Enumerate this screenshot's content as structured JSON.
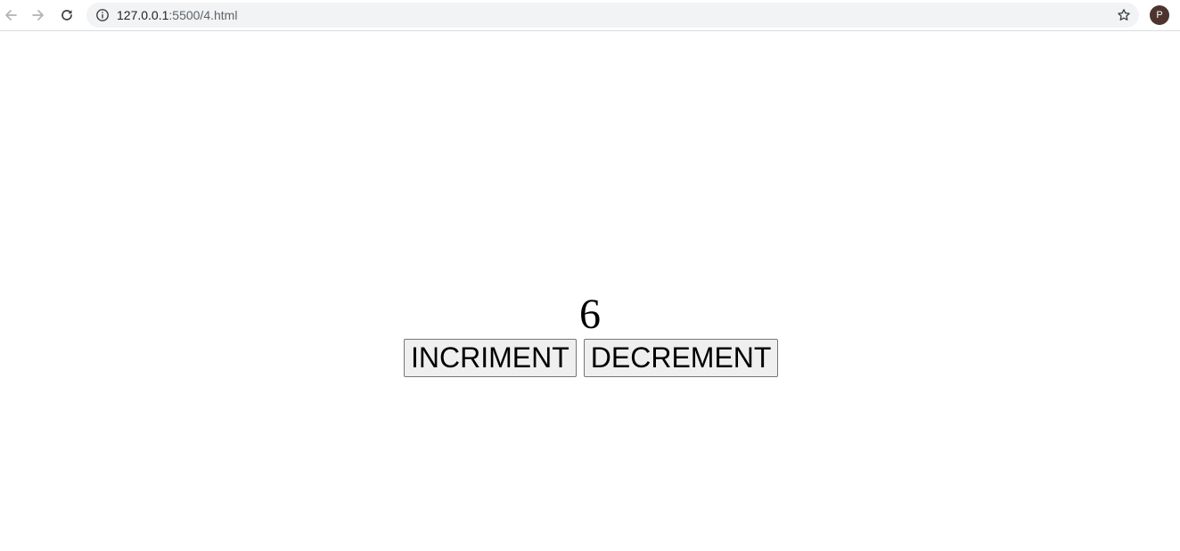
{
  "browser": {
    "url_host": "127.0.0.1",
    "url_rest": ":5500/4.html",
    "profile_initial": "P",
    "avatar_color": "#4e342e"
  },
  "icons": {
    "back": "arrow-left-icon",
    "forward": "arrow-right-icon",
    "reload": "reload-icon",
    "site_info": "info-icon",
    "bookmark": "star-icon"
  },
  "counter": {
    "value": "6"
  },
  "buttons": {
    "increment_label": "INCRIMENT",
    "decrement_label": "DECREMENT"
  }
}
